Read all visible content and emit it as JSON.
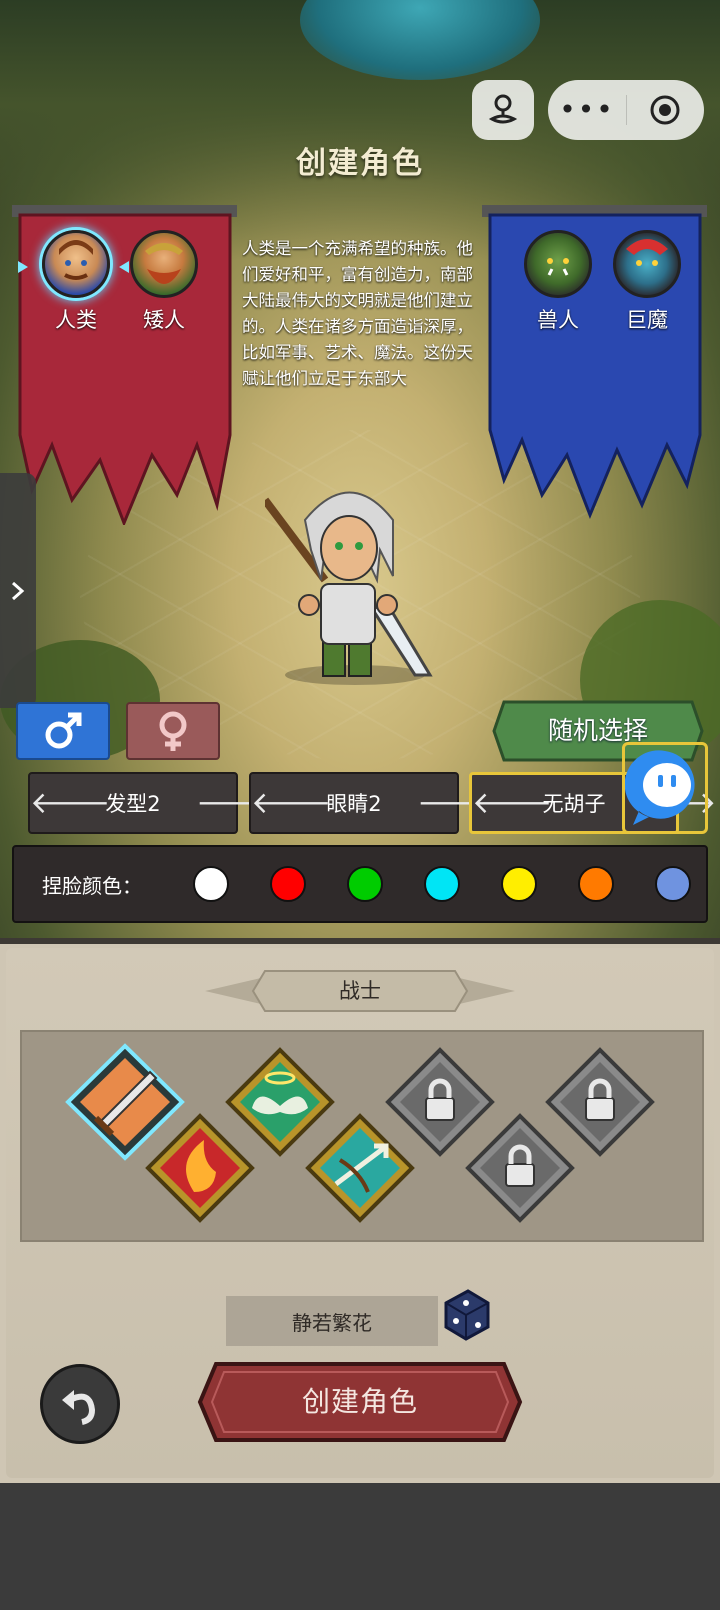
{
  "title": "创建角色",
  "races_left": [
    {
      "name": "人类",
      "selected": true
    },
    {
      "name": "矮人",
      "selected": false
    }
  ],
  "races_right": [
    {
      "name": "兽人"
    },
    {
      "name": "巨魔"
    }
  ],
  "race_description": "人类是一个充满希望的种族。他们爱好和平，富有创造力，南部大陆最伟大的文明就是他们建立的。人类在诸多方面造诣深厚，比如军事、艺术、魔法。这份天赋让他们立足于东部大",
  "gender": {
    "male_symbol": "♂",
    "female_symbol": "♀",
    "selected": "male"
  },
  "random_button": "随机选择",
  "selectors": [
    {
      "label": "发型2"
    },
    {
      "label": "眼睛2"
    },
    {
      "label": "无胡子"
    }
  ],
  "face_color": {
    "label": "捏脸颜色：",
    "swatches": [
      "#ffffff",
      "#ff0000",
      "#00cc00",
      "#00e5f5",
      "#ffee00",
      "#ff7a00",
      "#6f93e0"
    ]
  },
  "class_name": "战士",
  "skills": [
    {
      "icon": "sword-skill-icon",
      "state": "selected"
    },
    {
      "icon": "fire-skill-icon",
      "state": "unlocked"
    },
    {
      "icon": "wings-skill-icon",
      "state": "unlocked"
    },
    {
      "icon": "crossbow-skill-icon",
      "state": "unlocked"
    },
    {
      "icon": "locked-skill-icon",
      "state": "locked"
    },
    {
      "icon": "locked-skill-icon",
      "state": "locked"
    },
    {
      "icon": "locked-skill-icon",
      "state": "locked"
    }
  ],
  "character_name": "静若繁花",
  "create_button": "创建角色",
  "colors": {
    "banner_red": "#a8283a",
    "banner_blue": "#2a48b0",
    "male_button": "#2f74d6",
    "random_button": "#4f8a4a",
    "create_button": "#8f3434",
    "highlight": "#e8c63a"
  }
}
